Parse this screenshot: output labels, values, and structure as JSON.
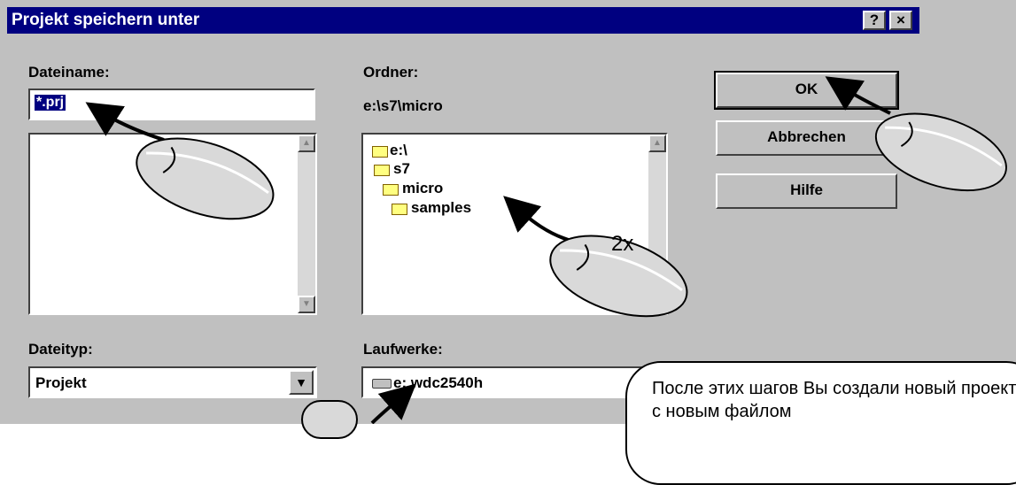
{
  "window": {
    "title": "Projekt speichern unter",
    "help_btn": "?",
    "close_btn": "×"
  },
  "filename": {
    "label": "Dateiname:",
    "value": "*.prj"
  },
  "folder": {
    "label": "Ordner:",
    "path": "e:\\s7\\micro",
    "items": [
      "e:\\",
      "s7",
      "micro",
      "samples"
    ]
  },
  "buttons": {
    "ok": "OK",
    "cancel": "Abbrechen",
    "help": "Hilfe"
  },
  "filetype": {
    "label": "Dateityp:",
    "value": "Projekt"
  },
  "drives": {
    "label": "Laufwerke:",
    "value": "e: wdc2540h"
  },
  "annotation": {
    "double_click": "2x",
    "callout_text": "После этих шагов Вы создали новый проект с новым файлом"
  },
  "icons": {
    "folder": "folder-icon",
    "drive": "drive-icon",
    "mouse": "mouse-icon",
    "dropdown": "chevron-down-icon"
  }
}
